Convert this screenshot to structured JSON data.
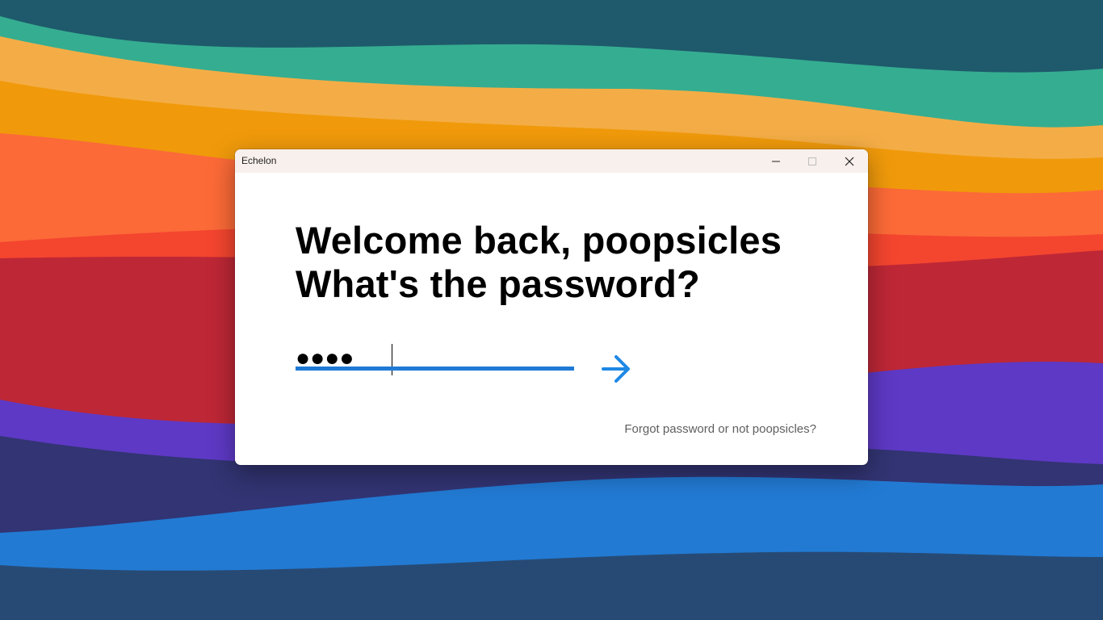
{
  "window": {
    "title": "Echelon"
  },
  "login": {
    "heading_line1": "Welcome back, poopsicles",
    "heading_line2": "What's the password?",
    "password_value": "●●●●",
    "submit_icon": "arrow-right-icon",
    "forgot_link": "Forgot password or not poopsicles?"
  },
  "colors": {
    "accent": "#1f7ad6",
    "arrow": "#1e88e5",
    "titlebar": "#f8f0ec",
    "link_text": "#5f5f5f"
  },
  "icons": {
    "minimize": "minimize-icon",
    "maximize": "maximize-icon",
    "close": "close-icon"
  }
}
